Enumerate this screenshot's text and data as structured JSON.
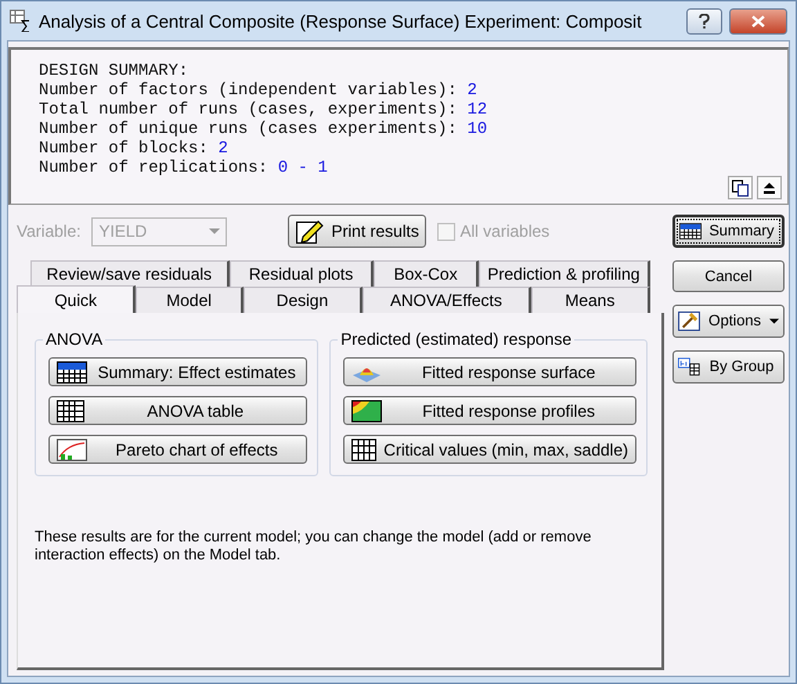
{
  "window": {
    "title": "Analysis of a Central Composite (Response Surface) Experiment: Composit"
  },
  "summary": {
    "heading": "DESIGN SUMMARY:",
    "lines": [
      {
        "label": "Number of factors (independent variables): ",
        "value": "2"
      },
      {
        "label": "Total number of runs (cases, experiments): ",
        "value": "12"
      },
      {
        "label": "Number of unique runs (cases experiments): ",
        "value": "10"
      },
      {
        "label": "Number of blocks: ",
        "value": "2"
      },
      {
        "label": "Number of replications: ",
        "value": "0 - 1"
      }
    ]
  },
  "variable": {
    "label": "Variable:",
    "value": "YIELD",
    "disabled": true
  },
  "print_button": "Print results",
  "all_variables": {
    "label": "All variables",
    "checked": false,
    "disabled": true
  },
  "tabs_back": [
    {
      "label": "Review/save residuals",
      "selected": false
    },
    {
      "label": "Residual plots",
      "selected": false
    },
    {
      "label": "Box-Cox",
      "selected": false
    },
    {
      "label": "Prediction & profiling",
      "selected": false
    }
  ],
  "tabs_front": [
    {
      "label": "Quick",
      "selected": true
    },
    {
      "label": "Model",
      "selected": false
    },
    {
      "label": "Design",
      "selected": false
    },
    {
      "label": "ANOVA/Effects",
      "selected": false
    },
    {
      "label": "Means",
      "selected": false
    }
  ],
  "groups": [
    {
      "title": "ANOVA",
      "buttons": [
        {
          "label": "Summary:  Effect estimates",
          "kind": "summary"
        },
        {
          "label": "ANOVA table",
          "kind": "table"
        },
        {
          "label": "Pareto chart of effects",
          "kind": "pareto"
        }
      ]
    },
    {
      "title": "Predicted (estimated) response",
      "buttons": [
        {
          "label": "Fitted response surface",
          "kind": "surface"
        },
        {
          "label": "Fitted response profiles",
          "kind": "contour"
        },
        {
          "label": "Critical values (min, max, saddle)",
          "kind": "grid"
        }
      ]
    }
  ],
  "note": "These results are for the current model; you can change the model (add or remove interaction effects) on the Model tab.",
  "side_buttons": [
    {
      "label": "Summary",
      "kind": "summary"
    },
    {
      "label": "Cancel",
      "kind": "plain"
    },
    {
      "label": "Options",
      "kind": "menu"
    },
    {
      "label": "By Group",
      "kind": "bygroup"
    }
  ]
}
